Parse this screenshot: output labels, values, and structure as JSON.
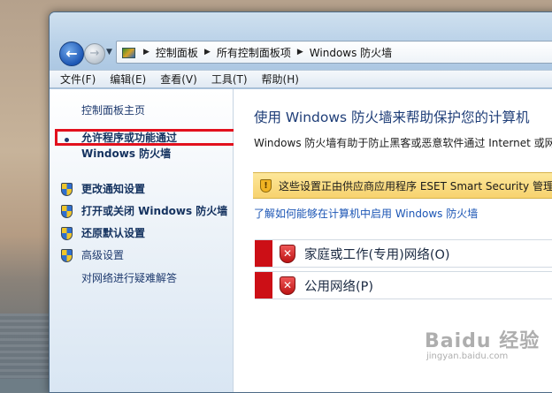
{
  "address_bar": {
    "crumbs": [
      "控制面板",
      "所有控制面板项",
      "Windows 防火墙"
    ]
  },
  "menu": [
    "文件(F)",
    "编辑(E)",
    "查看(V)",
    "工具(T)",
    "帮助(H)"
  ],
  "left_pane": {
    "home": "控制面板主页",
    "allow_line1": "允许程序或功能通过",
    "allow_line2": "Windows 防火墙",
    "notify": "更改通知设置",
    "toggle": "打开或关闭 Windows 防火墙",
    "restore": "还原默认设置",
    "advanced": "高级设置",
    "troubleshoot": "对网络进行疑难解答"
  },
  "main": {
    "title": "使用 Windows 防火墙来帮助保护您的计算机",
    "description": "Windows 防火墙有助于防止黑客或恶意软件通过 Internet 或网",
    "warning": "这些设置正由供应商应用程序 ESET Smart Security 管理",
    "help_link": "了解如何能够在计算机中启用 Windows 防火墙",
    "networks": [
      "家庭或工作(专用)网络(O)",
      "公用网络(P)"
    ]
  },
  "colors": {
    "highlight": "#e2101d",
    "network_status": "#cc0f16",
    "warning_bg": "#f7d26e"
  },
  "watermark": {
    "logo": "Baidu 经验",
    "url": "jingyan.baidu.com"
  }
}
